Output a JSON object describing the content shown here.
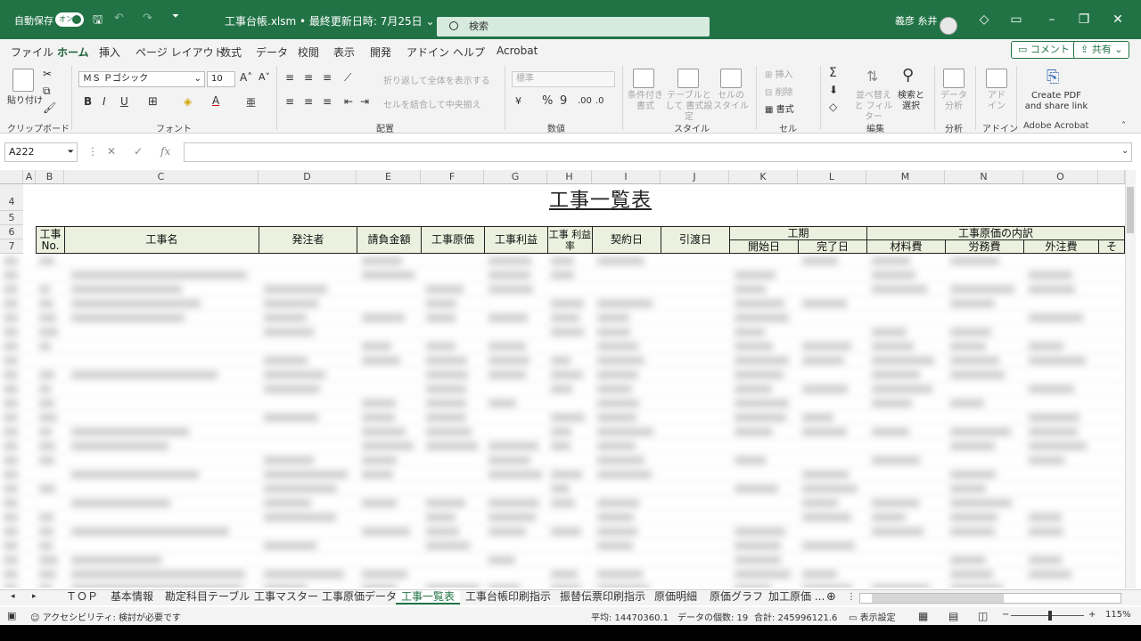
{
  "titlebar": {
    "autosave": "自動保存",
    "toggle": "オン",
    "doc_title": "工事台帳.xlsm • 最終更新日時: 7月25日 ⌄",
    "search_placeholder": "検索",
    "user": "義彦 糸井"
  },
  "menu": [
    "ファイル",
    "ホーム",
    "挿入",
    "ページ レイアウト",
    "数式",
    "データ",
    "校閲",
    "表示",
    "開発",
    "アドイン",
    "ヘルプ",
    "Acrobat"
  ],
  "menu_active": "ホーム",
  "comment_button": "コメント",
  "share_button": "共有",
  "ribbon": {
    "paste": "貼り付け",
    "font_name": "ＭＳ Ｐゴシック",
    "font_size": "10",
    "wrap_text": "折り返して全体を表示する",
    "merge_center": "セルを結合して中央揃え",
    "number_format": "標準",
    "cond_format": "条件付き 書式",
    "table_format": "テーブルとして 書式設定",
    "cell_style": "セルの スタイル",
    "insert": "挿入",
    "delete": "削除",
    "format": "書式",
    "sort_filter": "並べ替えと フィルター",
    "find_select": "検索と 選択",
    "data_analysis": "データ 分析",
    "addin": "アド イン",
    "create_pdf": "Create PDF and share link",
    "groups": [
      "クリップボード",
      "フォント",
      "配置",
      "数値",
      "スタイル",
      "セル",
      "編集",
      "分析",
      "アドイン",
      "Adobe Acrobat"
    ]
  },
  "formula_bar": {
    "name_box": "A222",
    "fx": "fx"
  },
  "columns": [
    "A",
    "B",
    "C",
    "D",
    "E",
    "F",
    "G",
    "H",
    "I",
    "J",
    "K",
    "L",
    "M",
    "N",
    "O"
  ],
  "rows": [
    "4",
    "5",
    "6",
    "7"
  ],
  "sheet_title": "工事一覧表",
  "header": {
    "koji_no": "工事 No.",
    "koji_name": "工事名",
    "client": "発注者",
    "contract_amount": "請負金額",
    "cost": "工事原価",
    "profit": "工事利益",
    "profit_rate": "工事 利益率",
    "contract_date": "契約日",
    "delivery_date": "引渡日",
    "period": "工期",
    "start_date": "開始日",
    "end_date": "完了日",
    "cost_breakdown": "工事原価の内訳",
    "material": "材料費",
    "labor": "労務費",
    "outsourcing": "外注費",
    "other": "そ"
  },
  "sheet_tabs": [
    "ＴＯＰ",
    "基本情報",
    "勘定科目テーブル",
    "工事マスター",
    "工事原価データ",
    "工事一覧表",
    "工事台帳印刷指示",
    "振替伝票印刷指示",
    "原価明細",
    "原価グラフ",
    "加工原価 ..."
  ],
  "active_sheet": "工事一覧表",
  "status": {
    "accessibility": "アクセシビリティ: 検討が必要です",
    "average": "平均: 14470360.1",
    "count": "データの個数: 19",
    "sum": "合計: 245996121.6",
    "display_settings": "表示設定",
    "zoom": "115%"
  },
  "colors": {
    "excel_green": "#217346",
    "header_fill": "#ebf1de"
  }
}
